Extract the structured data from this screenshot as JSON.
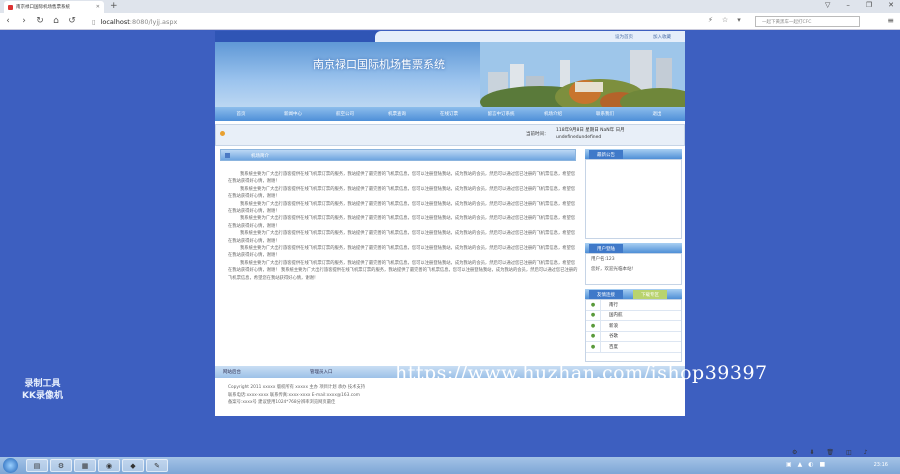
{
  "browser": {
    "tab_title": "南京禄口国际机场售票系统",
    "new_tab": "+",
    "window_controls": [
      "▽",
      "–",
      "❐",
      "✕"
    ],
    "url_host": "localhost",
    "url_path": ":8080/lyjj.aspx",
    "search_placeholder": "一起下黄黑车一起打CFC",
    "menu_icon": "≡"
  },
  "site": {
    "top_links": [
      "设为首页",
      "加入收藏"
    ],
    "title": "南京禄口国际机场售票系统",
    "menu": [
      "首页",
      "新闻中心",
      "航空公司",
      "机票查询",
      "在线订票",
      "留言中订系统",
      "机场介绍",
      "联系我们",
      "退出"
    ],
    "datetime_label": "当前时间：",
    "datetime_value": "118年9月8日 星期日 NaN年 日月 undefinedundefined",
    "panel_title": "机场简介",
    "paragraphs": [
      "我系统主要为广大出行旅客提供在线飞机票订票的服务，我站提供了最完善的飞机票信息，您可以注册登陆我站，成为我站的会员，然后可以通过您已注册的飞机票信息，希望您在我站获得好心情，谢谢！",
      "我系统主要为广大出行旅客提供在线飞机票订票的服务，我站提供了最完善的飞机票信息，您可以注册登陆我站，成为我站的会员，然后可以通过您已注册的飞机票信息，希望您在我站获得好心情，谢谢！",
      "我系统主要为广大出行旅客提供在线飞机票订票的服务，我站提供了最完善的飞机票信息，您可以注册登陆我站，成为我站的会员，然后可以通过您已注册的飞机票信息，希望您在我站获得好心情，谢谢！",
      "我系统主要为广大出行旅客提供在线飞机票订票的服务，我站提供了最完善的飞机票信息，您可以注册登陆我站，成为我站的会员，然后可以通过您已注册的飞机票信息，希望您在我站获得好心情，谢谢！",
      "我系统主要为广大出行旅客提供在线飞机票订票的服务，我站提供了最完善的飞机票信息，您可以注册登陆我站，成为我站的会员，然后可以通过您已注册的飞机票信息，希望您在我站获得好心情，谢谢！",
      "我系统主要为广大出行旅客提供在线飞机票订票的服务，我站提供了最完善的飞机票信息，您可以注册登陆我站，成为我站的会员，然后可以通过您已注册的飞机票信息，希望您在我站获得好心情，谢谢！",
      "我系统主要为广大出行旅客提供在线飞机票订票的服务，我站提供了最完善的飞机票信息，您可以注册登陆我站，成为我站的会员，然后可以通过您已注册的飞机票信息，希望您在我站获得好心情，谢谢！ 我系统主要为广大出行旅客提供在线飞机票订票的服务，我站提供了最完善的飞机票信息，您可以注册登陆我站，成为我站的会员，然后可以通过您已注册的飞机票信息，希望您在我站获得好心情，谢谢！"
    ],
    "sidebar": {
      "announcements_title": "最新公告",
      "user_title": "用户登陆",
      "user_name": "用户名:123",
      "user_line2": "您好，欢迎光临本站!",
      "links_title": "友情连接",
      "links_tab2": "下载专区",
      "links": [
        "南行",
        "国内航",
        "新浪",
        "谷歌",
        "百度"
      ]
    },
    "footer_bar": [
      "网站后台",
      "管理员入口"
    ],
    "footer_lines": [
      "Copyright 2011 xxxxx 版权所有 xxxxx 主办 项目计划 承办 技术支持",
      "联系电话:xxxx-xxxx 联系传真:xxxx-xxxx E-mail:xxxx@163.com",
      "备案号:xxxx号  建议使用1024*768分辨率浏览网页最佳"
    ]
  },
  "overlay": {
    "watermark": "https://www.huzhan.com/ishop39397",
    "recorder_line1": "录制工具",
    "recorder_line2": "KK录像机"
  },
  "taskbar": {
    "clock": "23:16"
  }
}
